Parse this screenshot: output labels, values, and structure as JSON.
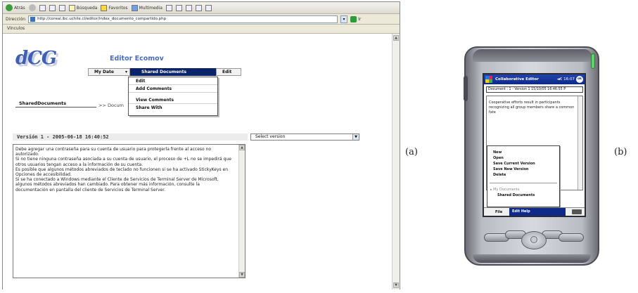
{
  "browser": {
    "toolbar": {
      "back_label": "Atrás",
      "search_label": "Búsqueda",
      "favorites_label": "Favoritos",
      "multimedia_label": "Multimedia"
    },
    "address": {
      "label": "Dirección",
      "url": "http://coreal.ibc.uchile.cl/editor/index_documento_compartido.php",
      "go_label": "Ir"
    },
    "links_label": "Vínculos"
  },
  "app": {
    "logo": "dCG",
    "title": "Editor Ecomov",
    "menu": {
      "my_data": "My Date",
      "shared_documents": "Shared Documents",
      "edit": "Edit"
    },
    "dropdown": [
      "Edit",
      "Add Comments",
      "View Comments",
      "Share With"
    ],
    "breadcrumb": {
      "current": "SharedDocuments",
      "rest": ">> Docum"
    },
    "version_header": "Versión 1 - 2005-06-18 16:40:52",
    "version_select": "Select version",
    "document_text": "Debe agregar una contraseña para su cuenta de usuario para protegerla frente al acceso no autorizado.\nSi no tiene ninguna contraseña asociada a su cuenta de usuario, el proceso de +L no se impedirá que otros usuarios tengan acceso a la información de su cuenta.\nEs posible que algunos métodos abreviados de teclado no funcionen si se ha activado StickyKeys en Opciones de accesibilidad.\nSi se ha conectado a Windows mediante el Cliente de Servicios de Terminal Server de Microsoft, algunos métodos abreviados han cambiado. Para obtener más información, consulte la documentación en pantalla del cliente de Servicios de Terminal Server."
  },
  "labels": {
    "a": "(a)",
    "b": "(b)"
  },
  "pda": {
    "title": "Collaborative Editor",
    "status": "◄€ 16:07",
    "ok": "ok",
    "document_field": "Document : 1 - Version 1 15/10/05 16:46:55 P",
    "text": "Cooperative efforts result in participants recognizing all group members share a common fate",
    "menu_items": [
      "New",
      "Open",
      "Save Current Version",
      "Save New Version",
      "Delete"
    ],
    "my_documents": "My Documents",
    "shared_documents": "Shared Documents",
    "menubar": {
      "file": "File",
      "edit_help": "Edit Help"
    }
  }
}
